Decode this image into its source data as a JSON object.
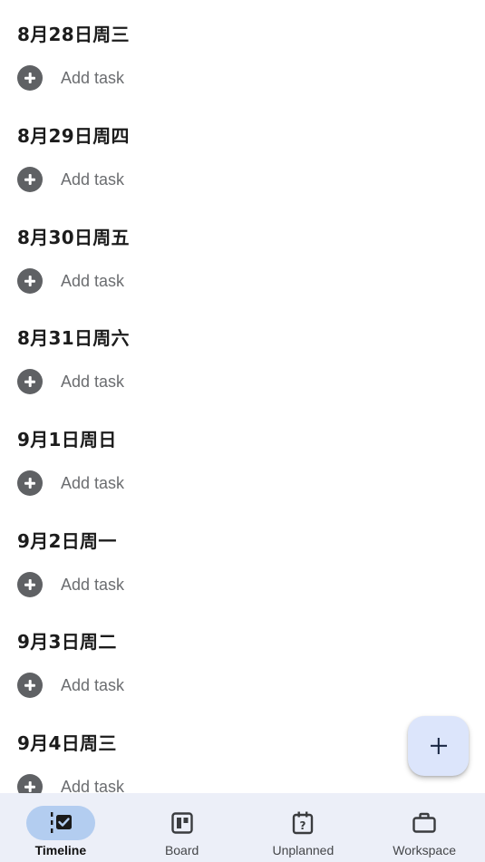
{
  "timeline": {
    "days": [
      {
        "title": "8月28日周三",
        "add_label": "Add task"
      },
      {
        "title": "8月29日周四",
        "add_label": "Add task"
      },
      {
        "title": "8月30日周五",
        "add_label": "Add task"
      },
      {
        "title": "8月31日周六",
        "add_label": "Add task"
      },
      {
        "title": "9月1日周日",
        "add_label": "Add task"
      },
      {
        "title": "9月2日周一",
        "add_label": "Add task"
      },
      {
        "title": "9月3日周二",
        "add_label": "Add task"
      },
      {
        "title": "9月4日周三",
        "add_label": "Add task"
      }
    ]
  },
  "fab": {
    "icon": "plus-icon"
  },
  "bottom_nav": {
    "active": "Timeline",
    "items": [
      {
        "label": "Timeline",
        "icon": "timeline-icon"
      },
      {
        "label": "Board",
        "icon": "board-icon"
      },
      {
        "label": "Unplanned",
        "icon": "unplanned-calendar-icon"
      },
      {
        "label": "Workspace",
        "icon": "briefcase-icon"
      }
    ]
  },
  "colors": {
    "accent_pill": "#b3cdf0",
    "fab_background": "#dce5fb",
    "nav_background": "#eceff8",
    "add_icon": "#5f6164"
  }
}
